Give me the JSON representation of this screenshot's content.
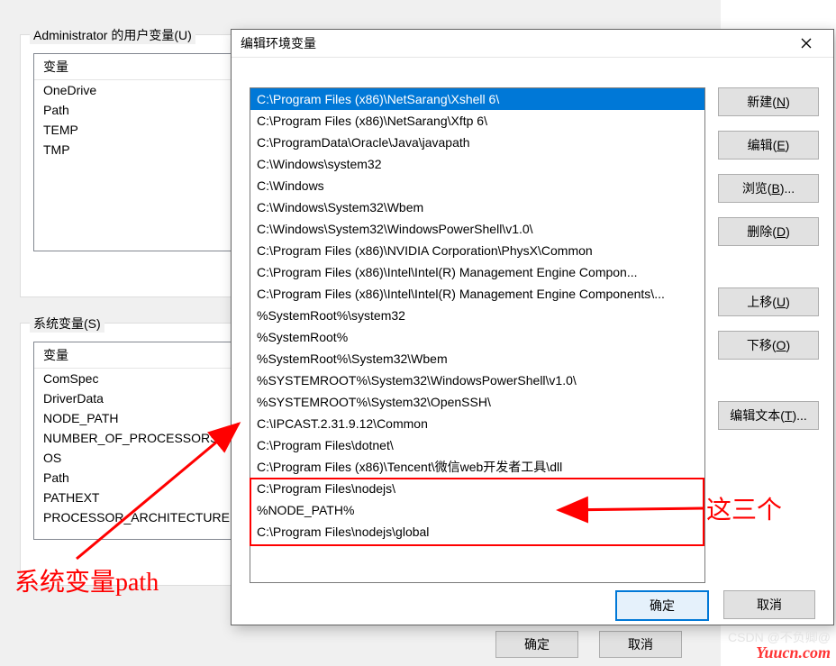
{
  "bg": {
    "user_group": "Administrator 的用户变量(U)",
    "sys_group": "系统变量(S)",
    "col_var": "变量",
    "user_vars": [
      "OneDrive",
      "Path",
      "TEMP",
      "TMP"
    ],
    "sys_vars": [
      "ComSpec",
      "DriverData",
      "NODE_PATH",
      "NUMBER_OF_PROCESSORS",
      "OS",
      "Path",
      "PATHEXT",
      "PROCESSOR_ARCHITECTURE"
    ],
    "ok": "确定",
    "cancel": "取消"
  },
  "dlg": {
    "title": "编辑环境变量",
    "paths": [
      "C:\\Program Files (x86)\\NetSarang\\Xshell 6\\",
      "C:\\Program Files (x86)\\NetSarang\\Xftp 6\\",
      "C:\\ProgramData\\Oracle\\Java\\javapath",
      "C:\\Windows\\system32",
      "C:\\Windows",
      "C:\\Windows\\System32\\Wbem",
      "C:\\Windows\\System32\\WindowsPowerShell\\v1.0\\",
      "C:\\Program Files (x86)\\NVIDIA Corporation\\PhysX\\Common",
      "C:\\Program Files (x86)\\Intel\\Intel(R) Management Engine Compon...",
      "C:\\Program Files (x86)\\Intel\\Intel(R) Management Engine Components\\...",
      "%SystemRoot%\\system32",
      "%SystemRoot%",
      "%SystemRoot%\\System32\\Wbem",
      "%SYSTEMROOT%\\System32\\WindowsPowerShell\\v1.0\\",
      "%SYSTEMROOT%\\System32\\OpenSSH\\",
      "C:\\IPCAST.2.31.9.12\\Common",
      "C:\\Program Files\\dotnet\\",
      "C:\\Program Files (x86)\\Tencent\\微信web开发者工具\\dll",
      "C:\\Program Files\\nodejs\\",
      "%NODE_PATH%",
      "C:\\Program Files\\nodejs\\global"
    ],
    "selected": 0,
    "buttons": {
      "new": "新建(N)",
      "edit": "编辑(E)",
      "browse": "浏览(B)...",
      "delete": "删除(D)",
      "up": "上移(U)",
      "down": "下移(O)",
      "edit_text": "编辑文本(T)..."
    },
    "ok": "确定",
    "cancel": "取消"
  },
  "annot": {
    "left": "系统变量path",
    "right": "这三个"
  },
  "watermark": "CSDN @不负卿@",
  "yuucn": "Yuucn.com"
}
